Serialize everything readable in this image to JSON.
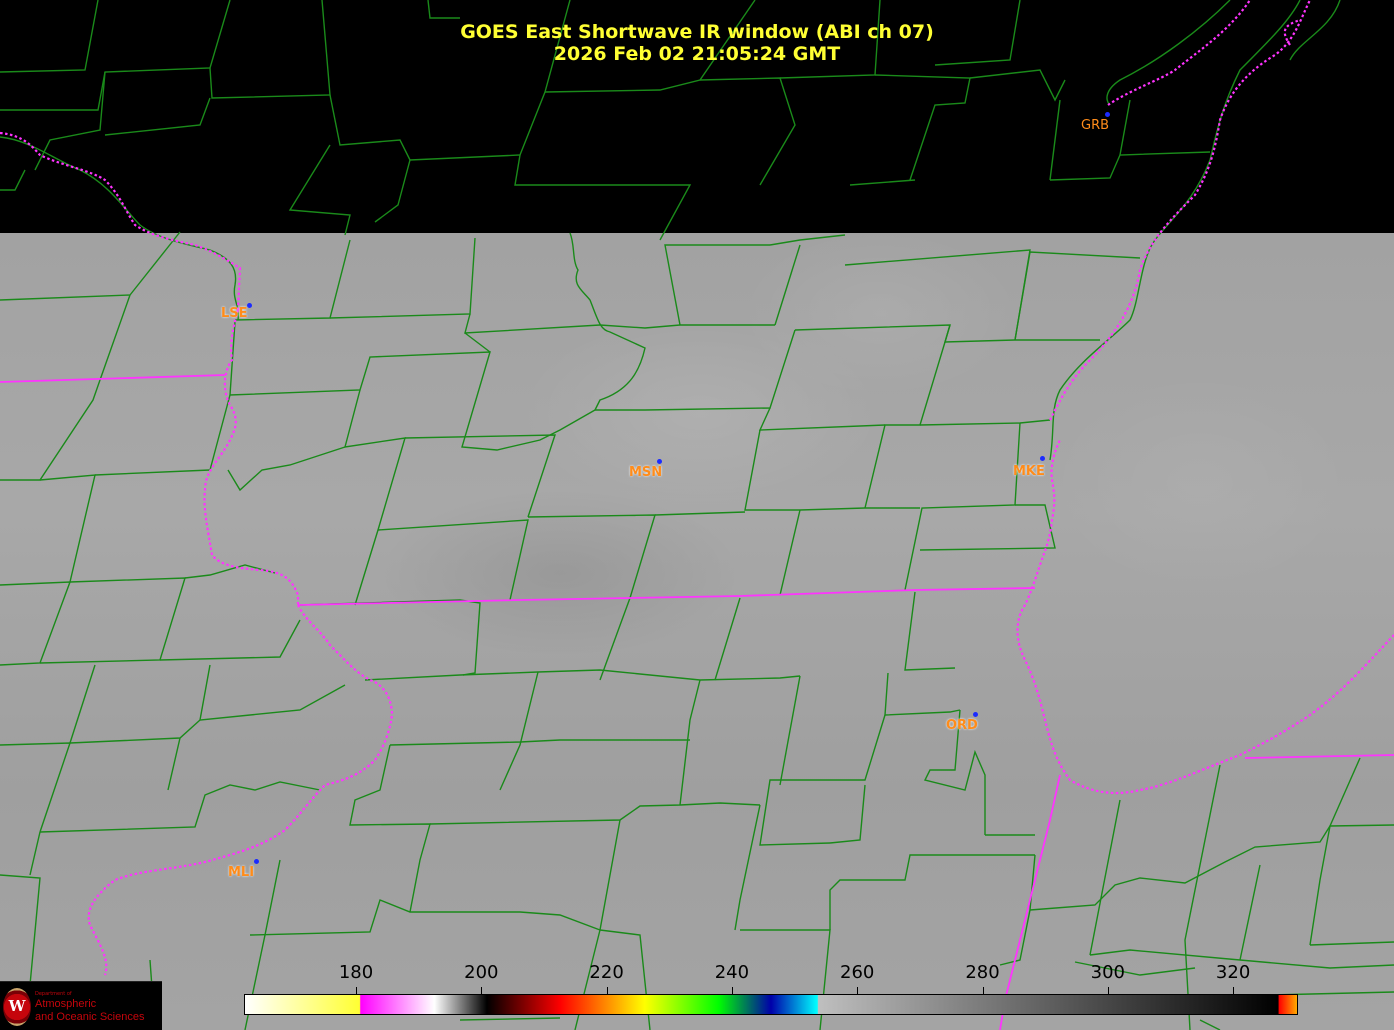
{
  "title": {
    "line1": "GOES East Shortwave IR window (ABI ch 07)",
    "line2": "2026 Feb 02  21:05:24 GMT"
  },
  "stations": [
    {
      "id": "GRB",
      "label": "GRB"
    },
    {
      "id": "LSE",
      "label": "LSE"
    },
    {
      "id": "MSN",
      "label": "MSN"
    },
    {
      "id": "MKE",
      "label": "MKE"
    },
    {
      "id": "ORD",
      "label": "ORD"
    },
    {
      "id": "MLI",
      "label": "MLI"
    }
  ],
  "colorbar": {
    "ticks": [
      "180",
      "200",
      "220",
      "240",
      "260",
      "280",
      "300",
      "320"
    ],
    "stops": [
      "#ffffff",
      "#ffff33",
      "#ff00ff",
      "#ffffff",
      "#000000",
      "#ff0000",
      "#ffff00",
      "#00ff00",
      "#0000aa",
      "#00ffff",
      "#bfbfbf",
      "#000000",
      "#ff0000",
      "#ffaa00"
    ]
  },
  "colors": {
    "county_lines": "#1a8a1a",
    "state_lines": "#ff33ff",
    "title_text": "#ffff33",
    "station_label": "#ff8c1a",
    "station_dot": "#1b2bff"
  },
  "logo": {
    "dept_text": "Department of",
    "line1": "Atmospheric",
    "line2": "and Oceanic Sciences",
    "mark": "W"
  }
}
